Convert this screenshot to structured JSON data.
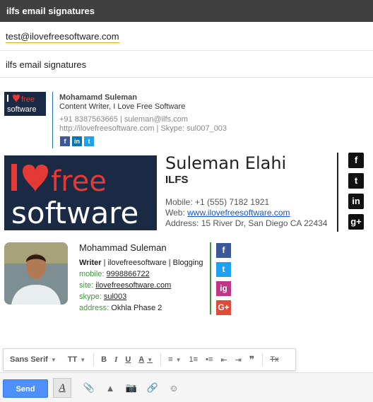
{
  "window": {
    "title": "ilfs email signatures"
  },
  "compose": {
    "to": "test@ilovefreesoftware.com",
    "subject": "ilfs email signatures"
  },
  "signature1": {
    "logo_text": "I love free software",
    "name": "Mohamamd Suleman",
    "title": "Content Writer, I Love Free Software",
    "contact": "+91 8387563665 | suleman@ilfs.com",
    "web": "http://ilovefreesoftware.com | Skype: sul007_003",
    "social": [
      "f",
      "in",
      "t"
    ]
  },
  "signature2": {
    "logo_text": "I love free software",
    "name": "Suleman Elahi",
    "company": "ILFS",
    "mobile_label": "Mobile: ",
    "mobile": "+1 (555) 7182 1921",
    "web_label": "Web: ",
    "web": "www.ilovefreesoftware.com",
    "address": "Address: 15 River Dr, San Diego CA 22434",
    "social": [
      "f",
      "t",
      "in",
      "g+"
    ]
  },
  "signature3": {
    "name": "Mohammad Suleman",
    "role_bold": "Writer",
    "role_rest": " | ilovefreesoftware | Blogging",
    "mobile_label": "mobile:",
    "mobile": "9998866722",
    "site_label": "site:",
    "site": "ilovefreesoftware.com",
    "skype_label": "skype:",
    "skype": "sul003",
    "address_label": "address:",
    "address": "Okhla Phase 2",
    "social": [
      "f",
      "t",
      "ig",
      "G+"
    ]
  },
  "toolbar": {
    "font": "Sans Serif",
    "size_icon": "TT",
    "bold": "B",
    "italic": "I",
    "underline": "U",
    "color": "A",
    "align": "≡",
    "numbered": "1≡",
    "bulleted": "•≡",
    "indent_less": "⇤",
    "indent_more": "⇥",
    "quote": "❞",
    "clear": "Tx"
  },
  "bottom": {
    "send_label": "Send",
    "format_label": "A",
    "icons": [
      "📎",
      "▲",
      "📷",
      "🔗",
      "☺"
    ]
  },
  "colors": {
    "facebook": "#3b5998",
    "linkedin": "#0077b5",
    "twitter": "#1da1f2",
    "instagram": "#c13584",
    "googleplus": "#dd4b39",
    "send": "#4d90fe",
    "accent_green": "#3d9a3d",
    "logo_bg": "#1a2a44"
  }
}
